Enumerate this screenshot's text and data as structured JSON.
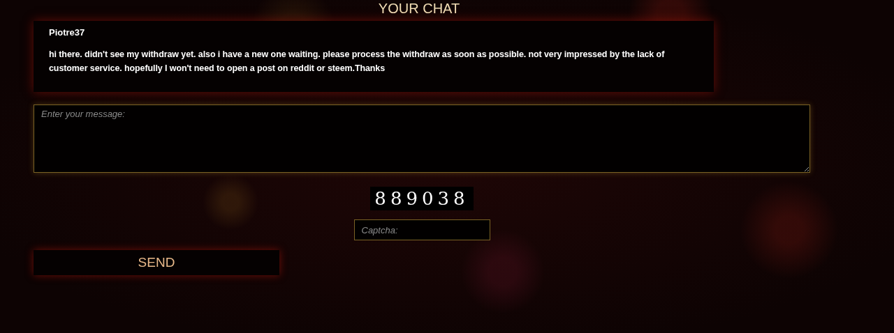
{
  "title": "YOUR CHAT",
  "messages": [
    {
      "author": "Piotre37",
      "text": "hi there. didn't see my withdraw yet. also i have a new one waiting. please process the withdraw as soon as possible. not very impressed by the lack of customer service. hopefully I won't need to open a post on reddit or steem.Thanks"
    }
  ],
  "message_field": {
    "placeholder": "Enter your message:"
  },
  "captcha": {
    "code": "889038",
    "placeholder": "Captcha:"
  },
  "send_button": "SEND"
}
